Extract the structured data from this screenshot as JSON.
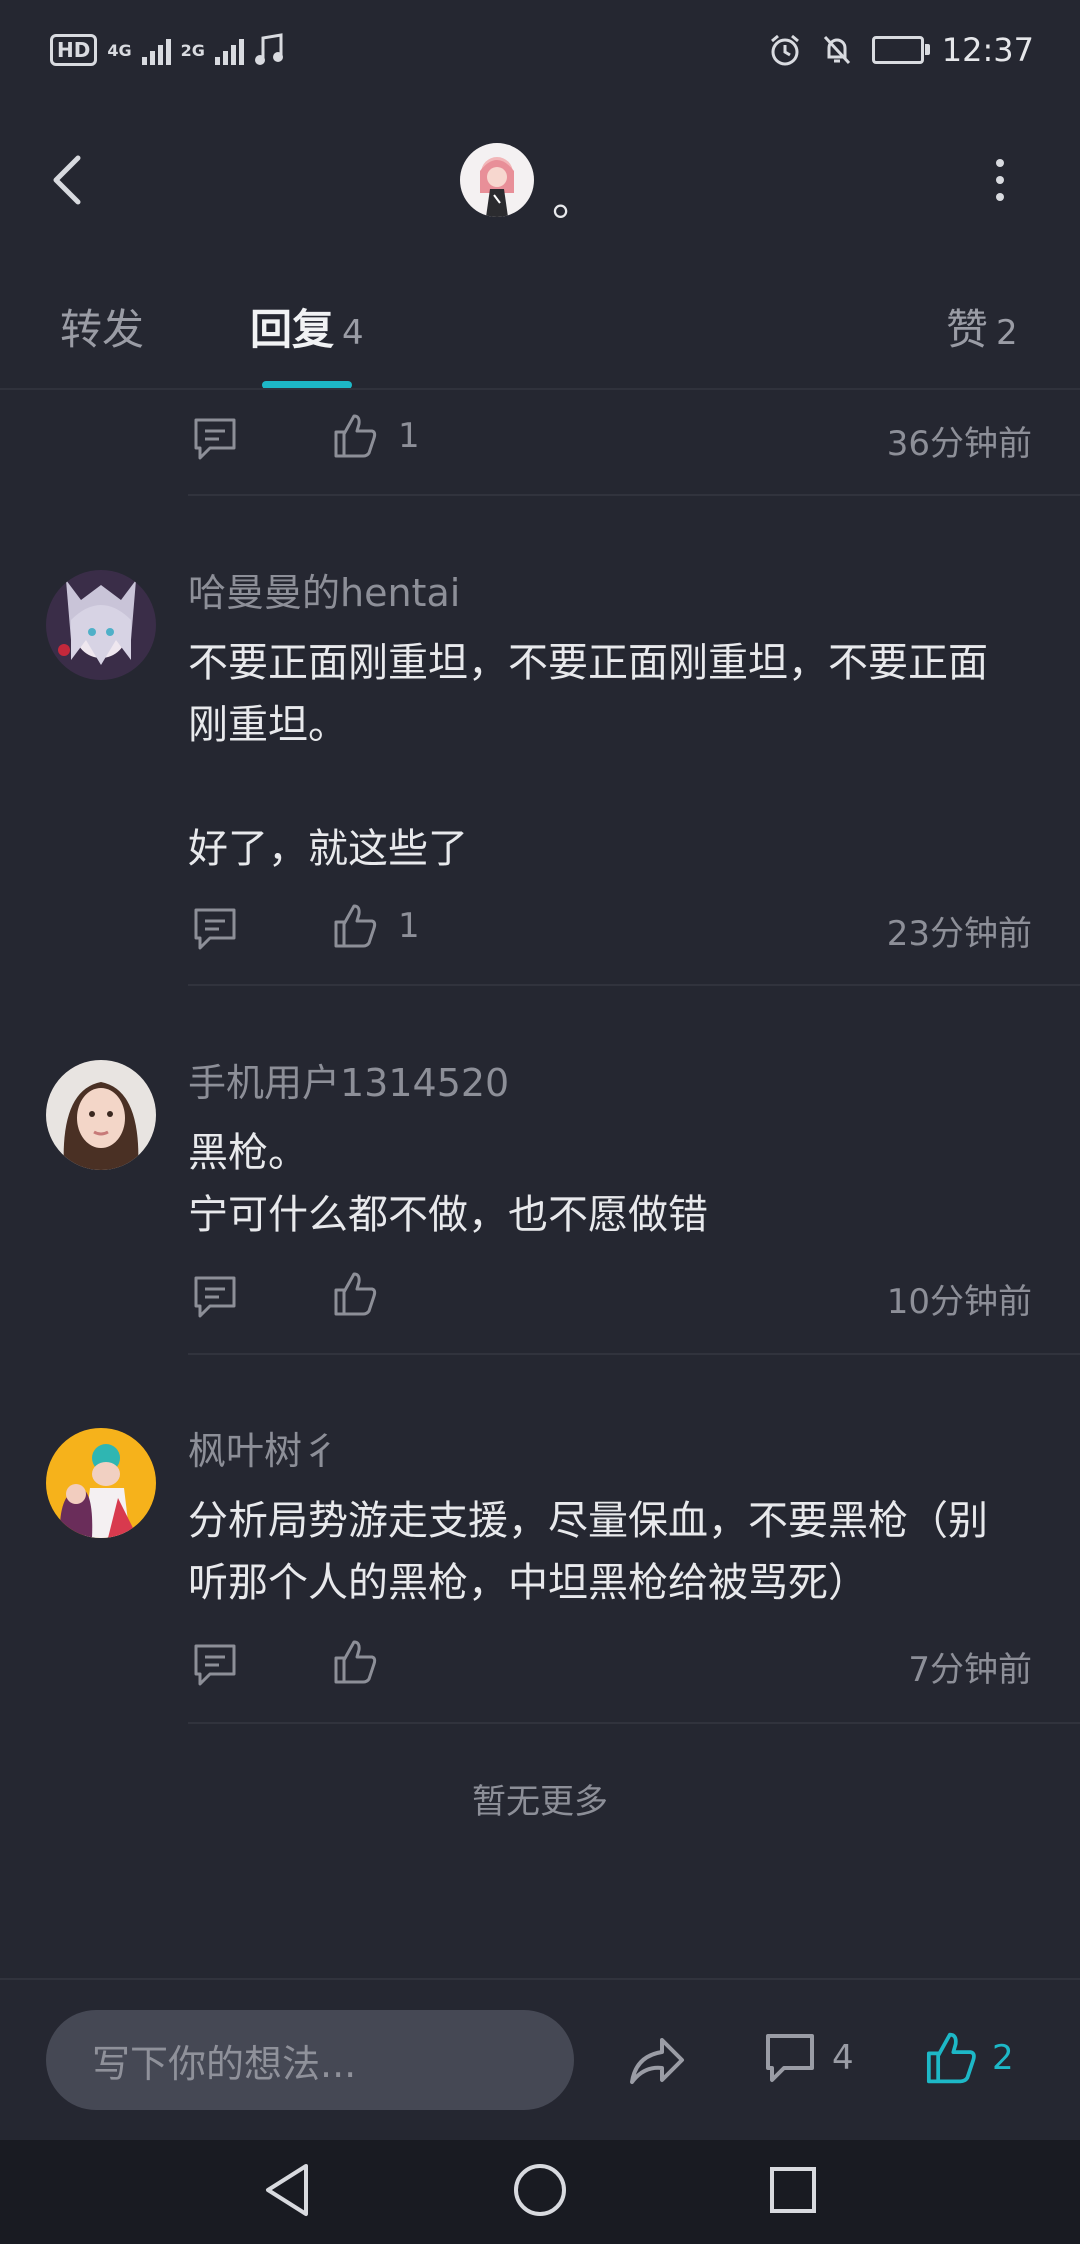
{
  "status_bar": {
    "hd": "HD",
    "sim1": "4G",
    "sim2": "2G",
    "time": "12:37"
  },
  "header": {
    "title": "。"
  },
  "tabs": [
    {
      "label": "转发",
      "count": ""
    },
    {
      "label": "回复",
      "count": "4"
    },
    {
      "label": "赞",
      "count": "2"
    }
  ],
  "comments": [
    {
      "name": "",
      "text": "",
      "likes": "1",
      "time": "36分钟前"
    },
    {
      "name": "哈曼曼的hentai",
      "text": "不要正面刚重坦，不要正面刚重坦，不要正面\n刚重坦。\n\n好了，就这些了",
      "likes": "1",
      "time": "23分钟前"
    },
    {
      "name": "手机用户1314520",
      "text": "黑枪。\n宁可什么都不做，也不愿做错",
      "likes": "",
      "time": "10分钟前"
    },
    {
      "name": "枫叶树彳",
      "text": "分析局势游走支援，尽量保血，不要黑枪（别\n听那个人的黑枪，中坦黑枪给被骂死）",
      "likes": "",
      "time": "7分钟前"
    }
  ],
  "no_more": "暂无更多",
  "bottom_bar": {
    "input_placeholder": "写下你的想法...",
    "comment_count": "4",
    "like_count": "2"
  },
  "colors": {
    "background": "#252731",
    "accent": "#1db8c7",
    "muted_text": "#8d8f98"
  },
  "icons": [
    "back-icon",
    "more-icon",
    "comment-icon",
    "like-icon",
    "share-icon",
    "nav-back-icon",
    "nav-home-icon",
    "nav-recents-icon"
  ]
}
